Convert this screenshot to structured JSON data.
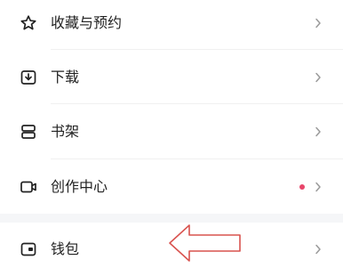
{
  "menu": {
    "items": [
      {
        "label": "收藏与预约",
        "icon": "star-icon"
      },
      {
        "label": "下载",
        "icon": "download-icon"
      },
      {
        "label": "书架",
        "icon": "bookshelf-icon"
      },
      {
        "label": "创作中心",
        "icon": "video-camera-icon",
        "badge": "red-dot"
      },
      {
        "label": "钱包",
        "icon": "wallet-icon"
      }
    ]
  },
  "chevron_icon": "chevron-right-icon",
  "colors": {
    "badge_dot": "#e8456a",
    "annotation_arrow": "#d9534f",
    "section_gap": "#f5f6f8",
    "chevron": "#9a9a9a"
  }
}
